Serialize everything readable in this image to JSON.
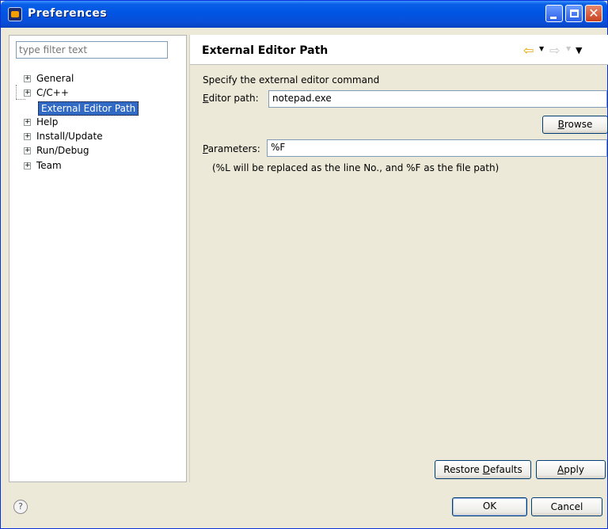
{
  "window": {
    "title": "Preferences"
  },
  "filter": {
    "placeholder": "type filter text"
  },
  "tree": {
    "items": [
      {
        "label": "General"
      },
      {
        "label": "C/C++"
      },
      {
        "label": "External Editor Path"
      },
      {
        "label": "Help"
      },
      {
        "label": "Install/Update"
      },
      {
        "label": "Run/Debug"
      },
      {
        "label": "Team"
      }
    ]
  },
  "page": {
    "title": "External Editor Path",
    "description": "Specify the external editor command",
    "editor_label_mnemonic": "E",
    "editor_label_rest": "ditor path:",
    "editor_value": "notepad.exe",
    "browse_label_mnemonic": "B",
    "browse_label_rest": "rowse",
    "params_label_mnemonic": "P",
    "params_label_rest": "arameters:",
    "params_value": "%F",
    "hint": "(%L will be replaced as the line No., and %F as the file path)",
    "restore_label_pre": "Restore ",
    "restore_label_mnemonic": "D",
    "restore_label_rest": "efaults",
    "apply_label_mnemonic": "A",
    "apply_label_rest": "pply"
  },
  "footer": {
    "help_glyph": "?",
    "ok_label": "OK",
    "cancel_label": "Cancel"
  },
  "icons": {
    "back": "back-arrow-icon",
    "forward": "forward-arrow-icon",
    "menu": "view-menu-icon",
    "help": "help-icon"
  },
  "colors": {
    "titlebar": "#0054e3",
    "selection": "#316ac5",
    "back_arrow": "#e0a800"
  }
}
